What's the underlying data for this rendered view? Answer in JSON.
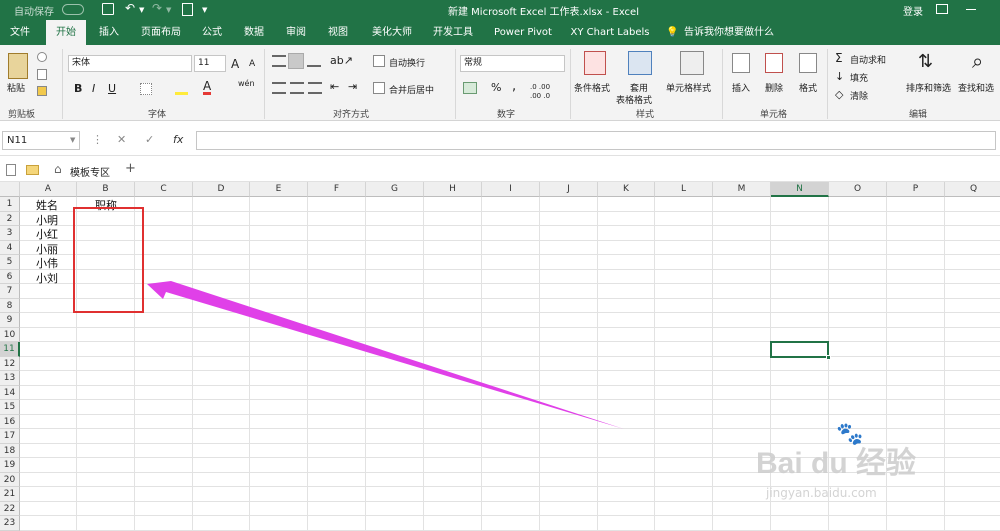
{
  "titlebar": {
    "autosave": "自动保存",
    "autosave_state": "关",
    "title": "新建 Microsoft Excel 工作表.xlsx  -  Excel",
    "login": "登录"
  },
  "tabs": [
    "文件",
    "开始",
    "插入",
    "页面布局",
    "公式",
    "数据",
    "审阅",
    "视图",
    "美化大师",
    "开发工具",
    "Power Pivot",
    "XY Chart Labels"
  ],
  "tell_me": "告诉我你想要做什么",
  "ribbon": {
    "clipboard": {
      "paste": "粘贴",
      "label": "剪贴板"
    },
    "font": {
      "name": "宋体",
      "size": "11",
      "label": "字体",
      "bold": "B",
      "italic": "I",
      "underline": "U",
      "grow": "A",
      "shrink": "A",
      "wen": "wén"
    },
    "alignment": {
      "wrap": "自动换行",
      "merge": "合并后居中",
      "label": "对齐方式"
    },
    "number": {
      "format": "常规",
      "percent": "%",
      "comma": ",",
      "label": "数字",
      "inc": ".0 .00",
      "dec": ".00 .0"
    },
    "styles": {
      "conditional": "条件格式",
      "table1": "套用",
      "table2": "表格格式",
      "cell_styles": "单元格样式",
      "label": "样式"
    },
    "cells": {
      "insert": "插入",
      "delete": "删除",
      "format": "格式",
      "label": "单元格"
    },
    "editing": {
      "autosum": "自动求和",
      "fill": "填充",
      "clear": "清除",
      "sort": "排序和筛选",
      "find": "查找和选",
      "label": "编辑"
    }
  },
  "formula": {
    "namebox": "N11",
    "fx": "fx",
    "value": ""
  },
  "workspace": {
    "tab": "模板专区",
    "add": "+"
  },
  "columns": [
    "A",
    "B",
    "C",
    "D",
    "E",
    "F",
    "G",
    "H",
    "I",
    "J",
    "K",
    "L",
    "M",
    "N",
    "O",
    "P",
    "Q"
  ],
  "rows": [
    "1",
    "2",
    "3",
    "4",
    "5",
    "6",
    "7",
    "8",
    "9",
    "10",
    "11",
    "12",
    "13",
    "14",
    "15",
    "16",
    "17",
    "18",
    "19",
    "20",
    "21",
    "22",
    "23"
  ],
  "cells": [
    {
      "ref": "A1",
      "text": "姓名"
    },
    {
      "ref": "B1",
      "text": "职称"
    },
    {
      "ref": "A2",
      "text": "小明"
    },
    {
      "ref": "A3",
      "text": "小红"
    },
    {
      "ref": "A4",
      "text": "小丽"
    },
    {
      "ref": "A5",
      "text": "小伟"
    },
    {
      "ref": "A6",
      "text": "小刘"
    }
  ],
  "selected_cell": "N11",
  "annotation": {
    "box_color": "#e03030",
    "arrow_color": "#e040e8"
  },
  "watermark": {
    "brand": "Bai du 经验",
    "url": "jingyan.baidu.com"
  },
  "colors": {
    "accent": "#217346"
  }
}
